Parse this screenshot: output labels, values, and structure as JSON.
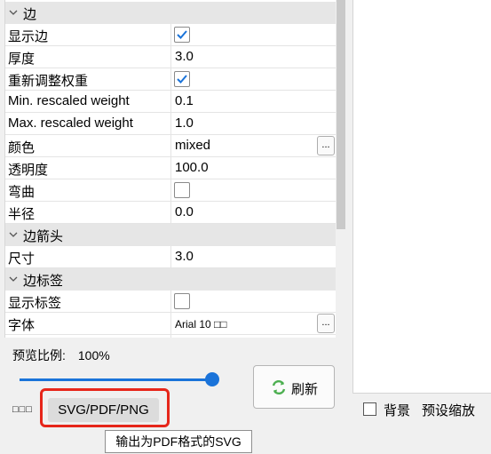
{
  "categories": {
    "edge": "边",
    "edge_arrow": "边箭头",
    "edge_label": "边标签"
  },
  "rows": {
    "show_edge": {
      "name": "显示边",
      "checked": true
    },
    "thickness": {
      "name": "厚度",
      "value": "3.0"
    },
    "reweight": {
      "name": "重新调整权重",
      "checked": true
    },
    "min_weight": {
      "name": "Min. rescaled weight",
      "value": "0.1"
    },
    "max_weight": {
      "name": "Max. rescaled weight",
      "value": "1.0"
    },
    "color": {
      "name": "颜色",
      "value": "mixed",
      "button": "..."
    },
    "opacity": {
      "name": "透明度",
      "value": "100.0"
    },
    "curved": {
      "name": "弯曲",
      "checked": false
    },
    "radius": {
      "name": "半径",
      "value": "0.0"
    },
    "arrow_size": {
      "name": "尺寸",
      "value": "3.0"
    },
    "show_label": {
      "name": "显示标签",
      "checked": false
    },
    "font": {
      "name": "字体",
      "value": "Arial 10 □□",
      "button": "..."
    }
  },
  "preview": {
    "zoom_label": "预览比例:",
    "zoom_value": "100%",
    "zoom_level": 1.0
  },
  "refresh_button": "刷新",
  "export": {
    "prefix": "□□□",
    "button": "SVG/PDF/PNG",
    "tooltip": "输出为PDF格式的SVG"
  },
  "canvas_controls": {
    "background": "背景",
    "preset_zoom": "预设缩放"
  },
  "colors": {
    "accent": "#1a73d9",
    "highlight": "#e6261a",
    "check": "#1a73d9"
  }
}
